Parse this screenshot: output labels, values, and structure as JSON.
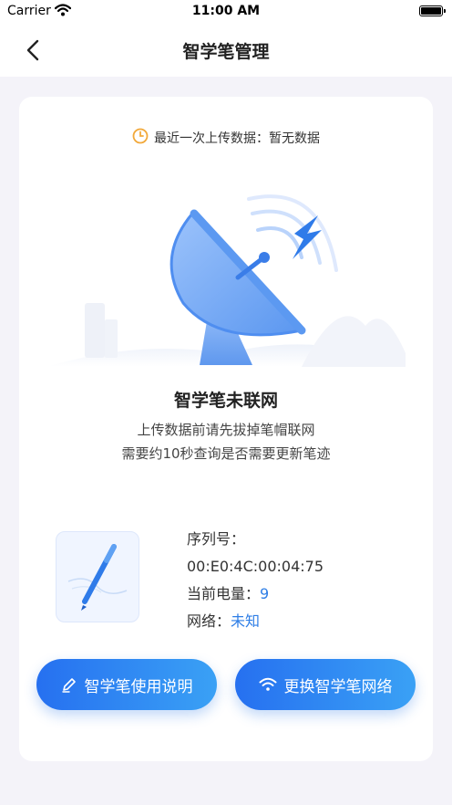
{
  "status_bar": {
    "carrier": "Carrier",
    "time": "11:00 AM"
  },
  "nav": {
    "title": "智学笔管理"
  },
  "upload": {
    "text": "最近一次上传数据：暂无数据"
  },
  "pen_status": {
    "title": "智学笔未联网",
    "line1": "上传数据前请先拔掉笔帽联网",
    "line2": "需要约10秒查询是否需要更新笔迹"
  },
  "device": {
    "serial_label": "序列号：",
    "serial_value": "00:E0:4C:00:04:75",
    "battery_label": "当前电量：",
    "battery_value": "9",
    "network_label": "网络：",
    "network_value": "未知"
  },
  "buttons": {
    "manual_label": "智学笔使用说明",
    "network_label": "更换智学笔网络"
  },
  "colors": {
    "accent": "#2e7ee6",
    "button_start": "#2670f0",
    "button_end": "#3aa1f5"
  },
  "icons": [
    "wifi-icon",
    "battery-icon",
    "back-chevron-icon",
    "clock-icon",
    "satellite-dish-icon",
    "pen-icon",
    "wifi-icon"
  ]
}
